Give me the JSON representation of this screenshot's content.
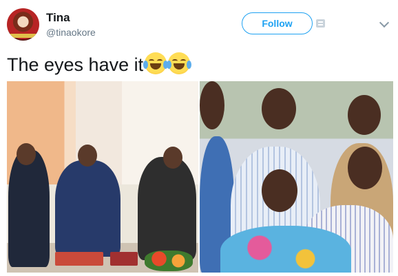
{
  "user": {
    "display_name": "Tina",
    "handle": "@tinaokore"
  },
  "actions": {
    "follow_label": "Follow"
  },
  "icons": {
    "translate": "translate-icon",
    "more": "chevron-down-icon",
    "emoji": "face-with-tears-of-joy-icon"
  },
  "tweet": {
    "text": "The eyes have it",
    "emoji_count": 2
  },
  "colors": {
    "accent": "#1da1f2",
    "text": "#14171a",
    "muted": "#657786"
  }
}
